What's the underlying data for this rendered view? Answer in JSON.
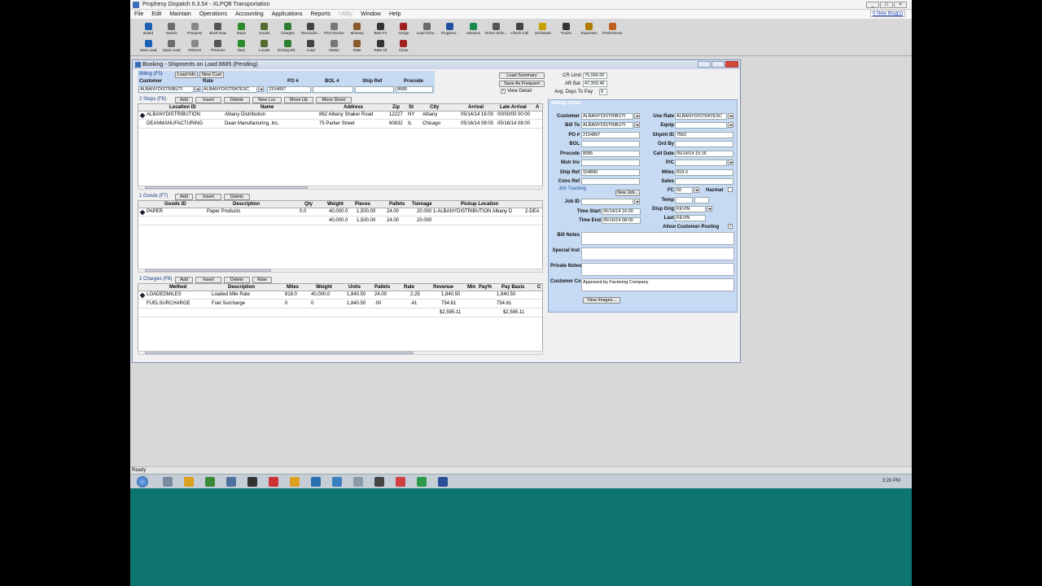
{
  "titlebar": {
    "title": "Prophesy Dispatch 6.3.54 - XLPQB Transportation"
  },
  "menu": [
    "File",
    "Edit",
    "Maintain",
    "Operations",
    "Accounting",
    "Applications",
    "Reports",
    "Utility",
    "Window",
    "Help"
  ],
  "new_msgs": "0 New Msg(s)",
  "toolbar1": [
    "Board",
    "Search",
    "Prequest",
    "Book Now",
    "Stops",
    "Goods",
    "Charges",
    "Reconcile...",
    "Print Invoice",
    "Itinerary",
    "Best Fit",
    "Assign",
    "Load Sche...",
    "Progress...",
    "Advance",
    "Driver Sche...",
    "Check Call",
    "Schloaset",
    "Trucks",
    "Expenses",
    "Preferences"
  ],
  "toolbar2": [
    "New Load",
    "Save Load",
    "Returns",
    "Previous",
    "Next",
    "Locate",
    "Driving Mil...",
    "Load",
    "Status",
    "Rate",
    "Rate All",
    "Close"
  ],
  "window": {
    "title": "Booking - Shipments on Load 8685 (Pending)"
  },
  "top_tabs": {
    "billing": "Billing (F5)",
    "load_info": "Load Info",
    "new_cust": "New Cust"
  },
  "top_grid": {
    "headers": [
      "Customer",
      "Rate",
      "PO #",
      "BOL #",
      "Ship Ref",
      "Procode"
    ],
    "values": [
      "ALBANYDISTRIBUTI",
      "ALBANYDISTRATESC",
      "2154897",
      "",
      "",
      "8685"
    ]
  },
  "buttons_right": {
    "load_summary": "Load Summary",
    "save_frequent": "Save As Frequent",
    "view_detail": "View Detail"
  },
  "credit": {
    "cr_limit_label": "CR Limit",
    "cr_limit": "75,000.00",
    "ar_bal_label": "AR Bal",
    "ar_bal": "47,303.45",
    "avg_days_label": "Avg. Days To Pay",
    "avg_days": "9"
  },
  "stops": {
    "label": "2 Stops (F6)",
    "buttons": [
      "Add",
      "Insert",
      "Delete",
      "New Loc",
      "Move Up",
      "Move Down"
    ],
    "headers": [
      "Location ID",
      "Name",
      "Address",
      "Zip",
      "St",
      "City",
      "Arrival",
      "Late Arrival",
      "A"
    ],
    "rows": [
      [
        "ALBANYDISTRIBUTION",
        "Albany Distribution",
        "862 Albany Shaker Road",
        "12227",
        "NY",
        "Albany",
        "05/14/14 16:00",
        "00/00/00 00:00"
      ],
      [
        "DEANMANUFACTURING",
        "Dean Manufacturing, Inc.",
        "75 Parker Street",
        "60632",
        "IL",
        "Chicago",
        "05/16/14 08:00",
        "05/16/14 08:00"
      ]
    ]
  },
  "goods": {
    "label": "1 Goods (F7)",
    "buttons": [
      "Add",
      "Insert",
      "Delete"
    ],
    "headers": [
      "Goods ID",
      "Description",
      "Qty",
      "Weight",
      "Pieces",
      "Pallets",
      "Tonnage",
      "Pickup Location"
    ],
    "rows": [
      [
        "PAPER",
        "Paper Products",
        "0.0",
        "40,000.0",
        "1,500.00",
        "24.00",
        "20.000",
        "1-ALBANYDISTRIBUTION Albany D",
        "2-DEA"
      ]
    ],
    "totals": [
      "40,000.0",
      "1,500.00",
      "24.00",
      "20.000"
    ]
  },
  "charges": {
    "label": "2 Charges (F8)",
    "buttons": [
      "Add",
      "Insert",
      "Delete",
      "Rate"
    ],
    "headers": [
      "Method",
      "Description",
      "Miles",
      "Weight",
      "Units",
      "Pallets",
      "Rate",
      "Revenue",
      "Min",
      "Pay%",
      "Pay Basis",
      "C"
    ],
    "rows": [
      [
        "LOADEDMILES",
        "Loaded Mile Rate",
        "818.0",
        "40,000.0",
        "1,840.50",
        "24.00",
        "2.25",
        "1,840.50",
        "1,840.50"
      ],
      [
        "FUELSURCHARGE",
        "Fuel Surcharge",
        "0",
        "0",
        "1,840.50",
        ".00",
        ".41",
        "754.61",
        "754.61"
      ]
    ],
    "totals": {
      "revenue": "$2,595.11",
      "pay_basis": "$2,595.11"
    }
  },
  "billing": {
    "title": "Billing Detail",
    "customer_label": "Customer",
    "customer": "ALBANYDISTRIBUTI",
    "bill_to_label": "Bill To",
    "bill_to": "ALBANYDISTRIBUTI",
    "po_label": "PO #",
    "po": "2154897",
    "bol_label": "BOL",
    "procode_label": "Procode",
    "procode": "8685",
    "mstr_inv_label": "Mstr Inv",
    "ship_ref_label": "Ship Ref",
    "ship_ref": "154895",
    "cons_ref_label": "Cons Ref",
    "job_tracking": "Job Tracking",
    "new_job": "New Job...",
    "job_id_label": "Job ID",
    "time_start_label": "Time Start",
    "time_start": "05/14/14 16:00",
    "time_end_label": "Time End",
    "time_end": "05/16/14 08:00",
    "use_rate_label": "Use Rate",
    "use_rate": "ALBANYDISTRATESC",
    "equip_label": "Equip",
    "shpmt_id_label": "Shpmt ID",
    "shpmt_id": "7562",
    "ord_by_label": "Ord By",
    "call_date_label": "Call Date",
    "call_date": "05/14/14 15:16",
    "pc_label": "P/C",
    "miles_label": "Miles",
    "miles": "818.0",
    "sales_label": "Sales",
    "fc_label": "FC",
    "fc": "50",
    "hazmat_label": "Hazmat",
    "temp_label": "Temp",
    "temp": "-",
    "disp_orig_label": "Disp Orig",
    "disp_orig": "KEVIN",
    "last_label": "Last",
    "last": "KEVIN",
    "allow_posting_label": "Allow Customer Posting",
    "bill_notes_label": "Bill Notes",
    "special_inst_label": "Special Inst",
    "private_notes_label": "Private Notes",
    "customer_comments_label": "Customer Comments",
    "customer_comments": "Approved by Factoring Company",
    "view_images": "View Images..."
  },
  "status": "Ready",
  "clock": "3:20 PM"
}
